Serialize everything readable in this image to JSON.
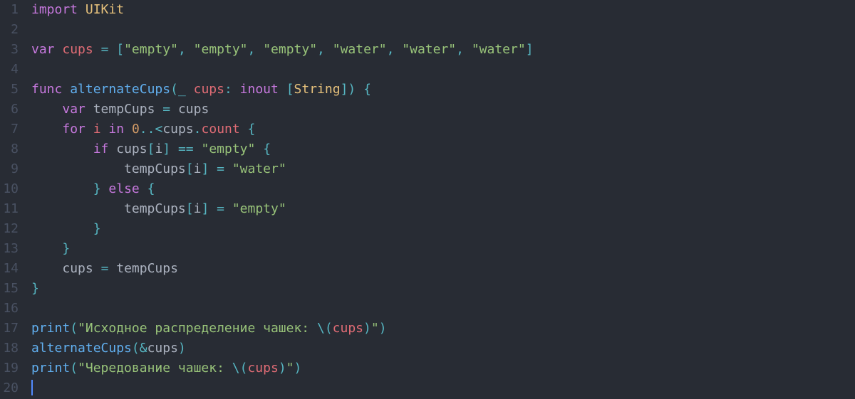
{
  "language": "swift",
  "gutter": [
    "1",
    "2",
    "3",
    "4",
    "5",
    "6",
    "7",
    "8",
    "9",
    "10",
    "11",
    "12",
    "13",
    "14",
    "15",
    "16",
    "17",
    "18",
    "19",
    "20"
  ],
  "code": {
    "lines": [
      [
        {
          "c": "kw",
          "t": "import"
        },
        {
          "c": "plain",
          "t": " "
        },
        {
          "c": "type",
          "t": "UIKit"
        }
      ],
      [],
      [
        {
          "c": "kw",
          "t": "var"
        },
        {
          "c": "plain",
          "t": " "
        },
        {
          "c": "id",
          "t": "cups"
        },
        {
          "c": "plain",
          "t": " "
        },
        {
          "c": "op",
          "t": "="
        },
        {
          "c": "plain",
          "t": " "
        },
        {
          "c": "op",
          "t": "["
        },
        {
          "c": "str",
          "t": "\"empty\""
        },
        {
          "c": "op",
          "t": ","
        },
        {
          "c": "plain",
          "t": " "
        },
        {
          "c": "str",
          "t": "\"empty\""
        },
        {
          "c": "op",
          "t": ","
        },
        {
          "c": "plain",
          "t": " "
        },
        {
          "c": "str",
          "t": "\"empty\""
        },
        {
          "c": "op",
          "t": ","
        },
        {
          "c": "plain",
          "t": " "
        },
        {
          "c": "str",
          "t": "\"water\""
        },
        {
          "c": "op",
          "t": ","
        },
        {
          "c": "plain",
          "t": " "
        },
        {
          "c": "str",
          "t": "\"water\""
        },
        {
          "c": "op",
          "t": ","
        },
        {
          "c": "plain",
          "t": " "
        },
        {
          "c": "str",
          "t": "\"water\""
        },
        {
          "c": "op",
          "t": "]"
        }
      ],
      [],
      [
        {
          "c": "kw",
          "t": "func"
        },
        {
          "c": "plain",
          "t": " "
        },
        {
          "c": "fn",
          "t": "alternateCups"
        },
        {
          "c": "op",
          "t": "("
        },
        {
          "c": "op",
          "t": "_"
        },
        {
          "c": "plain",
          "t": " "
        },
        {
          "c": "id",
          "t": "cups"
        },
        {
          "c": "op",
          "t": ":"
        },
        {
          "c": "plain",
          "t": " "
        },
        {
          "c": "kw",
          "t": "inout"
        },
        {
          "c": "plain",
          "t": " "
        },
        {
          "c": "op",
          "t": "["
        },
        {
          "c": "type",
          "t": "String"
        },
        {
          "c": "op",
          "t": "])"
        },
        {
          "c": "plain",
          "t": " "
        },
        {
          "c": "op",
          "t": "{"
        }
      ],
      [
        {
          "c": "plain",
          "t": "    "
        },
        {
          "c": "kw",
          "t": "var"
        },
        {
          "c": "plain",
          "t": " "
        },
        {
          "c": "plain",
          "t": "tempCups"
        },
        {
          "c": "plain",
          "t": " "
        },
        {
          "c": "op",
          "t": "="
        },
        {
          "c": "plain",
          "t": " "
        },
        {
          "c": "plain",
          "t": "cups"
        }
      ],
      [
        {
          "c": "plain",
          "t": "    "
        },
        {
          "c": "kw",
          "t": "for"
        },
        {
          "c": "plain",
          "t": " "
        },
        {
          "c": "id",
          "t": "i"
        },
        {
          "c": "plain",
          "t": " "
        },
        {
          "c": "kw",
          "t": "in"
        },
        {
          "c": "plain",
          "t": " "
        },
        {
          "c": "num",
          "t": "0"
        },
        {
          "c": "op",
          "t": ".."
        },
        {
          "c": "op",
          "t": "<"
        },
        {
          "c": "plain",
          "t": "cups"
        },
        {
          "c": "op",
          "t": "."
        },
        {
          "c": "prop",
          "t": "count"
        },
        {
          "c": "plain",
          "t": " "
        },
        {
          "c": "op",
          "t": "{"
        }
      ],
      [
        {
          "c": "plain",
          "t": "        "
        },
        {
          "c": "kw",
          "t": "if"
        },
        {
          "c": "plain",
          "t": " "
        },
        {
          "c": "plain",
          "t": "cups"
        },
        {
          "c": "op",
          "t": "["
        },
        {
          "c": "plain",
          "t": "i"
        },
        {
          "c": "op",
          "t": "]"
        },
        {
          "c": "plain",
          "t": " "
        },
        {
          "c": "op",
          "t": "=="
        },
        {
          "c": "plain",
          "t": " "
        },
        {
          "c": "str",
          "t": "\"empty\""
        },
        {
          "c": "plain",
          "t": " "
        },
        {
          "c": "op",
          "t": "{"
        }
      ],
      [
        {
          "c": "plain",
          "t": "            "
        },
        {
          "c": "plain",
          "t": "tempCups"
        },
        {
          "c": "op",
          "t": "["
        },
        {
          "c": "plain",
          "t": "i"
        },
        {
          "c": "op",
          "t": "]"
        },
        {
          "c": "plain",
          "t": " "
        },
        {
          "c": "op",
          "t": "="
        },
        {
          "c": "plain",
          "t": " "
        },
        {
          "c": "str",
          "t": "\"water\""
        }
      ],
      [
        {
          "c": "plain",
          "t": "        "
        },
        {
          "c": "op",
          "t": "}"
        },
        {
          "c": "plain",
          "t": " "
        },
        {
          "c": "kw",
          "t": "else"
        },
        {
          "c": "plain",
          "t": " "
        },
        {
          "c": "op",
          "t": "{"
        }
      ],
      [
        {
          "c": "plain",
          "t": "            "
        },
        {
          "c": "plain",
          "t": "tempCups"
        },
        {
          "c": "op",
          "t": "["
        },
        {
          "c": "plain",
          "t": "i"
        },
        {
          "c": "op",
          "t": "]"
        },
        {
          "c": "plain",
          "t": " "
        },
        {
          "c": "op",
          "t": "="
        },
        {
          "c": "plain",
          "t": " "
        },
        {
          "c": "str",
          "t": "\"empty\""
        }
      ],
      [
        {
          "c": "plain",
          "t": "        "
        },
        {
          "c": "op",
          "t": "}"
        }
      ],
      [
        {
          "c": "plain",
          "t": "    "
        },
        {
          "c": "op",
          "t": "}"
        }
      ],
      [
        {
          "c": "plain",
          "t": "    "
        },
        {
          "c": "plain",
          "t": "cups"
        },
        {
          "c": "plain",
          "t": " "
        },
        {
          "c": "op",
          "t": "="
        },
        {
          "c": "plain",
          "t": " "
        },
        {
          "c": "plain",
          "t": "tempCups"
        }
      ],
      [
        {
          "c": "op",
          "t": "}"
        }
      ],
      [],
      [
        {
          "c": "fn",
          "t": "print"
        },
        {
          "c": "op",
          "t": "("
        },
        {
          "c": "str",
          "t": "\"Исходное распределение чашек: "
        },
        {
          "c": "esc",
          "t": "\\("
        },
        {
          "c": "id",
          "t": "cups"
        },
        {
          "c": "esc",
          "t": ")"
        },
        {
          "c": "str",
          "t": "\""
        },
        {
          "c": "op",
          "t": ")"
        }
      ],
      [
        {
          "c": "fn",
          "t": "alternateCups"
        },
        {
          "c": "op",
          "t": "("
        },
        {
          "c": "op",
          "t": "&"
        },
        {
          "c": "plain",
          "t": "cups"
        },
        {
          "c": "op",
          "t": ")"
        }
      ],
      [
        {
          "c": "fn",
          "t": "print"
        },
        {
          "c": "op",
          "t": "("
        },
        {
          "c": "str",
          "t": "\"Чередование чашек: "
        },
        {
          "c": "esc",
          "t": "\\("
        },
        {
          "c": "id",
          "t": "cups"
        },
        {
          "c": "esc",
          "t": ")"
        },
        {
          "c": "str",
          "t": "\""
        },
        {
          "c": "op",
          "t": ")"
        }
      ],
      []
    ]
  },
  "cursor_line": 20
}
